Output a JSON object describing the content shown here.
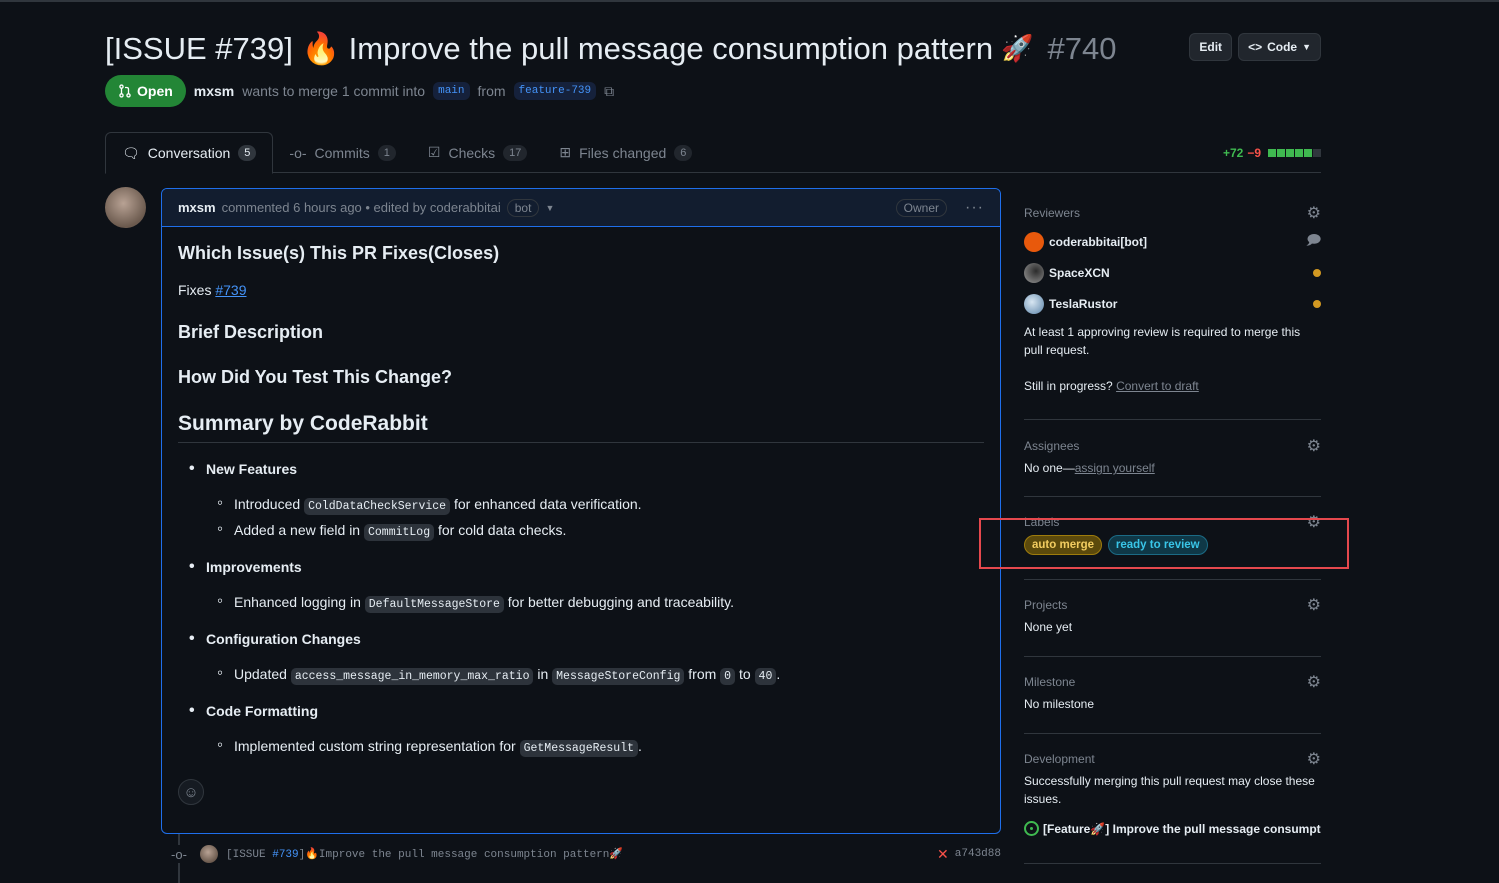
{
  "pr": {
    "title": "[ISSUE #739] 🔥 Improve the pull message consumption pattern",
    "rocket": "🚀",
    "number": "#740",
    "edit_label": "Edit",
    "code_label": "Code",
    "status": "Open",
    "author": "mxsm",
    "merge_text": "wants to merge 1 commit into",
    "base_branch": "main",
    "from_text": "from",
    "head_branch": "feature-739"
  },
  "tabs": [
    {
      "label": "Conversation",
      "count": "5",
      "icon": "comment-discussion-icon"
    },
    {
      "label": "Commits",
      "count": "1",
      "icon": "git-commit-icon"
    },
    {
      "label": "Checks",
      "count": "17",
      "icon": "checklist-icon"
    },
    {
      "label": "Files changed",
      "count": "6",
      "icon": "file-diff-icon"
    }
  ],
  "diffstat": {
    "additions": "+72",
    "deletions": "−9",
    "colors": {
      "add": "#3fb950",
      "del": "#f85149",
      "neutral": "#30363d"
    }
  },
  "comment": {
    "author": "mxsm",
    "meta": "commented 6 hours ago • edited by coderabbitai",
    "bot_badge": "bot",
    "owner_badge": "Owner",
    "heading_fixes": "Which Issue(s) This PR Fixes(Closes)",
    "fixes_label": "Fixes",
    "fixes_link": "#739",
    "heading_brief": "Brief Description",
    "heading_test": "How Did You Test This Change?",
    "heading_summary": "Summary by CodeRabbit",
    "sections": [
      {
        "title": "New Features",
        "items": [
          {
            "pre": "Introduced",
            "code": "ColdDataCheckService",
            "post": "for enhanced data verification."
          },
          {
            "pre": "Added a new field in",
            "code": "CommitLog",
            "post": "for cold data checks."
          }
        ]
      },
      {
        "title": "Improvements",
        "items": [
          {
            "pre": "Enhanced logging in",
            "code": "DefaultMessageStore",
            "post": "for better debugging and traceability."
          }
        ]
      },
      {
        "title": "Configuration Changes",
        "items": [
          {
            "pre": "Updated",
            "code": "access_message_in_memory_max_ratio",
            "mid1": "in",
            "code2": "MessageStoreConfig",
            "mid2": "from",
            "code3": "0",
            "mid3": "to",
            "code4": "40",
            "post": "."
          }
        ]
      },
      {
        "title": "Code Formatting",
        "items": [
          {
            "pre": "Implemented custom string representation for",
            "code": "GetMessageResult",
            "post": "."
          }
        ]
      }
    ]
  },
  "commit": {
    "prefix": "[ISSUE ",
    "issue": "#739",
    "suffix": "]🔥Improve the pull message consumption pattern🚀",
    "sha": "a743d88"
  },
  "sidebar": {
    "reviewers_title": "Reviewers",
    "reviewers": [
      {
        "name": "coderabbitai[bot]",
        "status": "commented",
        "avatar_color": "#e8590c"
      },
      {
        "name": "SpaceXCN",
        "status": "pending",
        "avatar_color": "#6e6e6e"
      },
      {
        "name": "TeslaRustor",
        "status": "pending",
        "avatar_color": "#7fa6c9"
      }
    ],
    "review_note": "At least 1 approving review is required to merge this pull request.",
    "progress_text": "Still in progress?",
    "draft_link": "Convert to draft",
    "assignees_title": "Assignees",
    "assignees_none": "No one—",
    "assign_link": "assign yourself",
    "labels_title": "Labels",
    "labels": [
      {
        "name": "auto merge",
        "bg": "#5c4a0c",
        "fg": "#f2cc60",
        "border": "#9e7c0c"
      },
      {
        "name": "ready to review",
        "bg": "#0f3847",
        "fg": "#39c5e8",
        "border": "#1b6b85"
      }
    ],
    "projects_title": "Projects",
    "projects_value": "None yet",
    "milestone_title": "Milestone",
    "milestone_value": "No milestone",
    "development_title": "Development",
    "development_text": "Successfully merging this pull request may close these issues.",
    "development_issue": "[Feature🚀] Improve the pull message consumpt..."
  }
}
